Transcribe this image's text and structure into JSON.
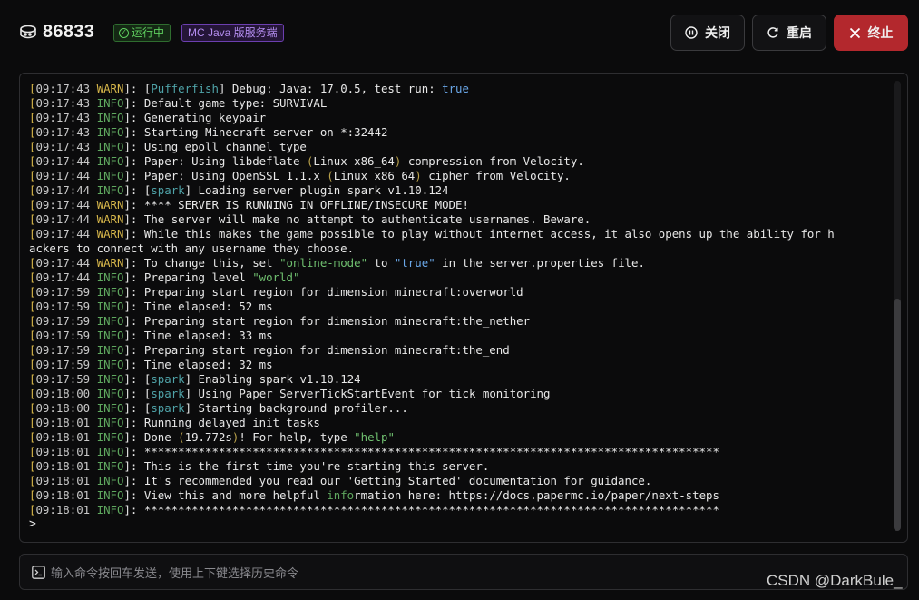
{
  "header": {
    "server_id": "86833",
    "status_badge": "运行中",
    "type_badge": "MC Java 版服务端",
    "buttons": {
      "close": "关闭",
      "restart": "重启",
      "kill": "终止"
    }
  },
  "colors": {
    "kill_button": "#b3282d",
    "status_green": "#5fcf5f",
    "type_purple": "#b48df0",
    "warn": "#d6b64a",
    "info": "#5fa85f"
  },
  "console": {
    "lines": [
      {
        "time": "09:17:43",
        "level": "WARN",
        "segs": [
          [
            "tx",
            "["
          ],
          [
            "tag",
            "Pufferfish"
          ],
          [
            "tx",
            "] Debug: Java: 17.0.5, test run: "
          ],
          [
            "kw",
            "true"
          ]
        ]
      },
      {
        "time": "09:17:43",
        "level": "INFO",
        "segs": [
          [
            "tx",
            "Default game type: SURVIVAL"
          ]
        ]
      },
      {
        "time": "09:17:43",
        "level": "INFO",
        "segs": [
          [
            "tx",
            "Generating keypair"
          ]
        ]
      },
      {
        "time": "09:17:43",
        "level": "INFO",
        "segs": [
          [
            "tx",
            "Starting Minecraft server on *:32442"
          ]
        ]
      },
      {
        "time": "09:17:43",
        "level": "INFO",
        "segs": [
          [
            "tx",
            "Using epoll channel type"
          ]
        ]
      },
      {
        "time": "09:17:44",
        "level": "INFO",
        "segs": [
          [
            "tx",
            "Paper: Using libdeflate "
          ],
          [
            "paren",
            "("
          ],
          [
            "tx",
            "Linux x86_64"
          ],
          [
            "paren",
            ")"
          ],
          [
            "tx",
            " compression from Velocity."
          ]
        ]
      },
      {
        "time": "09:17:44",
        "level": "INFO",
        "segs": [
          [
            "tx",
            "Paper: Using OpenSSL 1.1.x "
          ],
          [
            "paren",
            "("
          ],
          [
            "tx",
            "Linux x86_64"
          ],
          [
            "paren",
            ")"
          ],
          [
            "tx",
            " cipher from Velocity."
          ]
        ]
      },
      {
        "time": "09:17:44",
        "level": "INFO",
        "segs": [
          [
            "tx",
            "["
          ],
          [
            "tag",
            "spark"
          ],
          [
            "tx",
            "] Loading server plugin spark v1.10.124"
          ]
        ]
      },
      {
        "time": "09:17:44",
        "level": "WARN",
        "segs": [
          [
            "tx",
            "**** SERVER IS RUNNING IN OFFLINE/INSECURE MODE!"
          ]
        ]
      },
      {
        "time": "09:17:44",
        "level": "WARN",
        "segs": [
          [
            "tx",
            "The server will make no attempt to authenticate usernames. Beware."
          ]
        ]
      },
      {
        "time": "09:17:44",
        "level": "WARN",
        "segs": [
          [
            "tx",
            "While this makes the game possible to play without internet access, it also opens up the ability for h"
          ]
        ]
      },
      {
        "time": "",
        "level": "",
        "segs": [
          [
            "tx",
            "ackers to connect with any username they choose."
          ]
        ]
      },
      {
        "time": "09:17:44",
        "level": "WARN",
        "segs": [
          [
            "tx",
            "To change this, set "
          ],
          [
            "gr",
            "\"online-mode\""
          ],
          [
            "tx",
            " to "
          ],
          [
            "kw",
            "\"true\""
          ],
          [
            "tx",
            " in the server.properties file."
          ]
        ]
      },
      {
        "time": "09:17:44",
        "level": "INFO",
        "segs": [
          [
            "tx",
            "Preparing level "
          ],
          [
            "gr",
            "\"world\""
          ]
        ]
      },
      {
        "time": "09:17:59",
        "level": "INFO",
        "segs": [
          [
            "tx",
            "Preparing start region for dimension minecraft:overworld"
          ]
        ]
      },
      {
        "time": "09:17:59",
        "level": "INFO",
        "segs": [
          [
            "tx",
            "Time elapsed: 52 ms"
          ]
        ]
      },
      {
        "time": "09:17:59",
        "level": "INFO",
        "segs": [
          [
            "tx",
            "Preparing start region for dimension minecraft:the_nether"
          ]
        ]
      },
      {
        "time": "09:17:59",
        "level": "INFO",
        "segs": [
          [
            "tx",
            "Time elapsed: 33 ms"
          ]
        ]
      },
      {
        "time": "09:17:59",
        "level": "INFO",
        "segs": [
          [
            "tx",
            "Preparing start region for dimension minecraft:the_end"
          ]
        ]
      },
      {
        "time": "09:17:59",
        "level": "INFO",
        "segs": [
          [
            "tx",
            "Time elapsed: 32 ms"
          ]
        ]
      },
      {
        "time": "09:17:59",
        "level": "INFO",
        "segs": [
          [
            "tx",
            "["
          ],
          [
            "tag",
            "spark"
          ],
          [
            "tx",
            "] Enabling spark v1.10.124"
          ]
        ]
      },
      {
        "time": "09:18:00",
        "level": "INFO",
        "segs": [
          [
            "tx",
            "["
          ],
          [
            "tag",
            "spark"
          ],
          [
            "tx",
            "] Using Paper ServerTickStartEvent for tick monitoring"
          ]
        ]
      },
      {
        "time": "09:18:00",
        "level": "INFO",
        "segs": [
          [
            "tx",
            "["
          ],
          [
            "tag",
            "spark"
          ],
          [
            "tx",
            "] Starting background profiler..."
          ]
        ]
      },
      {
        "time": "09:18:01",
        "level": "INFO",
        "segs": [
          [
            "tx",
            "Running delayed init tasks"
          ]
        ]
      },
      {
        "time": "09:18:01",
        "level": "INFO",
        "segs": [
          [
            "tx",
            "Done "
          ],
          [
            "paren",
            "("
          ],
          [
            "tx",
            "19.772s"
          ],
          [
            "paren",
            ")"
          ],
          [
            "tx",
            "! For help, type "
          ],
          [
            "gr",
            "\"help\""
          ]
        ]
      },
      {
        "time": "09:18:01",
        "level": "INFO",
        "segs": [
          [
            "tx",
            "*************************************************************************************"
          ]
        ]
      },
      {
        "time": "09:18:01",
        "level": "INFO",
        "segs": [
          [
            "tx",
            "This is the first time you're starting this server."
          ]
        ]
      },
      {
        "time": "09:18:01",
        "level": "INFO",
        "segs": [
          [
            "tx",
            "It's recommended you read our 'Getting Started' documentation for guidance."
          ]
        ]
      },
      {
        "time": "09:18:01",
        "level": "INFO",
        "segs": [
          [
            "tx",
            "View this and more helpful "
          ],
          [
            "info",
            "info"
          ],
          [
            "tx",
            "rmation here: https://docs.papermc.io/paper/next-steps"
          ]
        ]
      },
      {
        "time": "09:18:01",
        "level": "INFO",
        "segs": [
          [
            "tx",
            "*************************************************************************************"
          ]
        ]
      }
    ],
    "prompt": ">"
  },
  "command": {
    "placeholder": "输入命令按回车发送，使用上下键选择历史命令"
  },
  "watermark": "CSDN @DarkBule_"
}
